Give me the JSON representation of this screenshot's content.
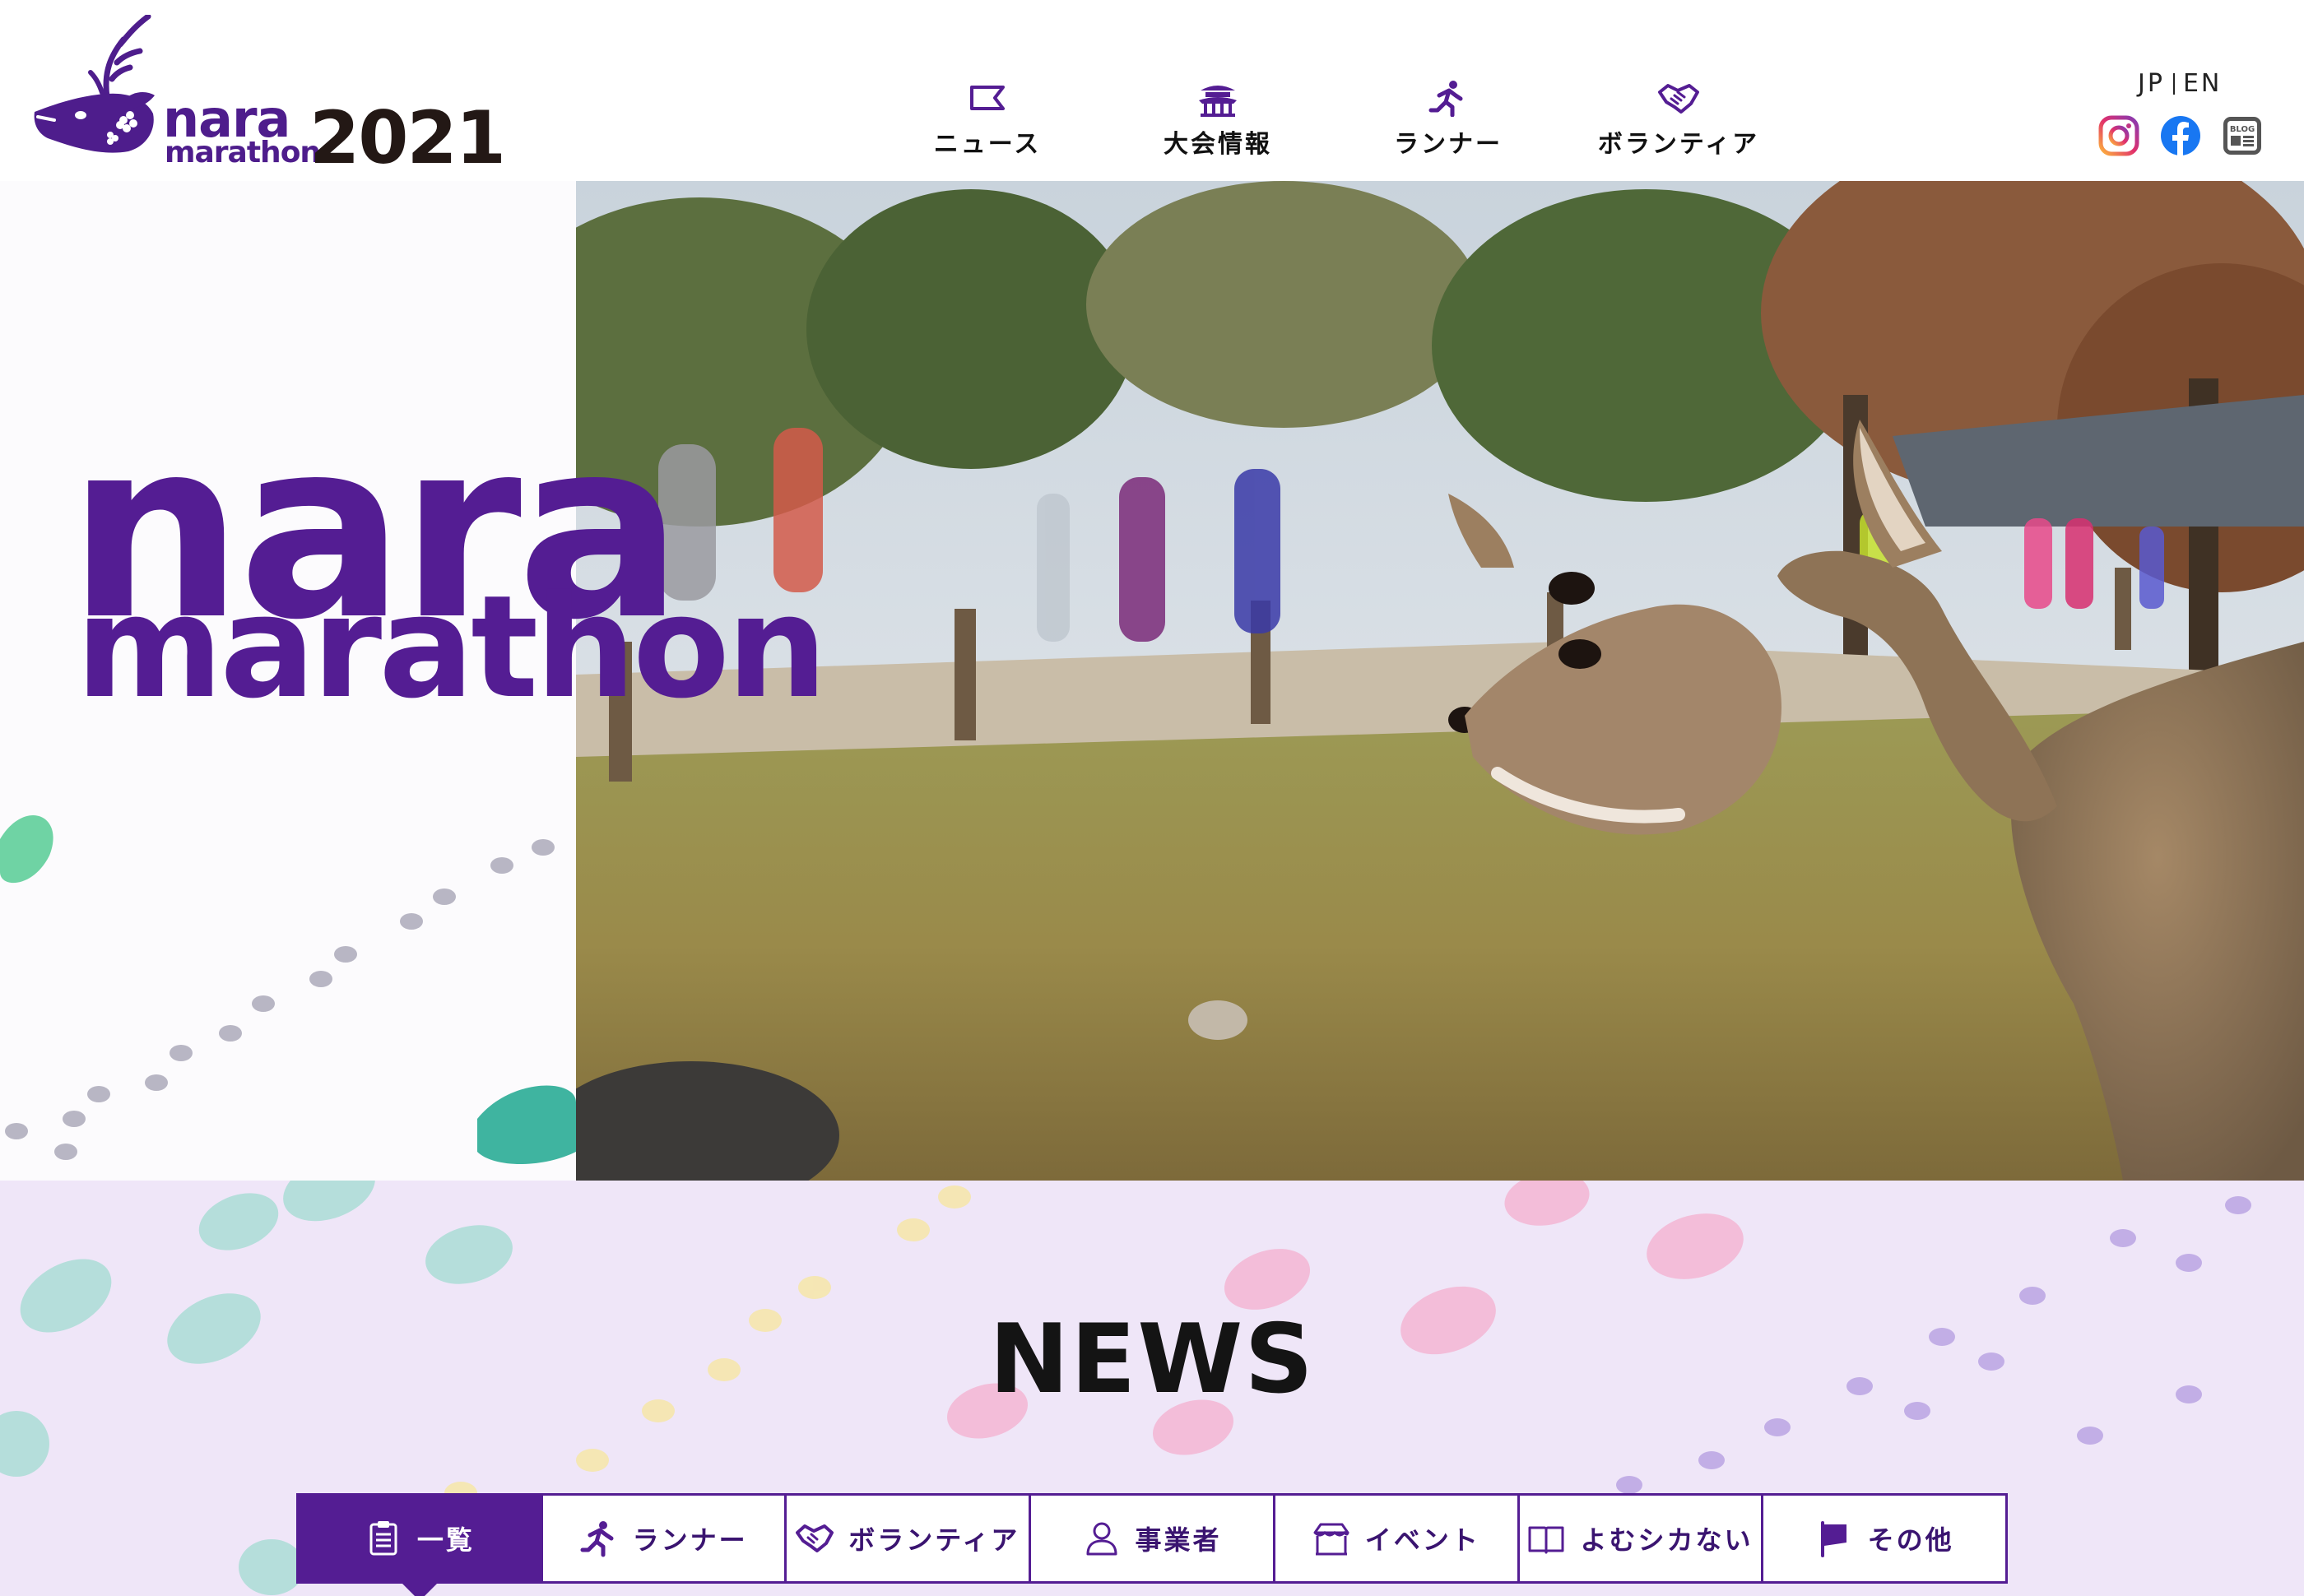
{
  "header": {
    "logo": {
      "word_top": "nara",
      "word_bottom": "marathon",
      "year": "2021"
    },
    "nav": [
      {
        "label": "ニュース",
        "icon": "flag-outline-icon"
      },
      {
        "label": "大会情報",
        "icon": "temple-icon"
      },
      {
        "label": "ランナー",
        "icon": "runner-icon"
      },
      {
        "label": "ボランティア",
        "icon": "handshake-icon"
      }
    ],
    "lang": {
      "jp": "JP",
      "en": "EN"
    },
    "social": [
      {
        "icon": "instagram-icon",
        "color": "#e1306c"
      },
      {
        "icon": "facebook-icon",
        "color": "#1877f2"
      },
      {
        "icon": "blog-icon",
        "color": "#555555",
        "text": "BLOG"
      }
    ]
  },
  "hero": {
    "title_line1": "nara",
    "title_line2": "marathon",
    "photo": "deer-and-runners-photo"
  },
  "news": {
    "title": "NEWS",
    "tabs": [
      {
        "label": "一覧",
        "icon": "clipboard-icon",
        "active": true
      },
      {
        "label": "ランナー",
        "icon": "runner-icon",
        "active": false
      },
      {
        "label": "ボランティア",
        "icon": "handshake-icon",
        "active": false
      },
      {
        "label": "事業者",
        "icon": "person-icon",
        "active": false
      },
      {
        "label": "イベント",
        "icon": "tent-icon",
        "active": false
      },
      {
        "label": "よむシカない",
        "icon": "book-icon",
        "active": false
      },
      {
        "label": "その他",
        "icon": "flag-icon",
        "active": false
      }
    ]
  },
  "colors": {
    "brand_purple": "#541d93",
    "news_bg": "#efe6f8",
    "text_dark": "#231815"
  }
}
